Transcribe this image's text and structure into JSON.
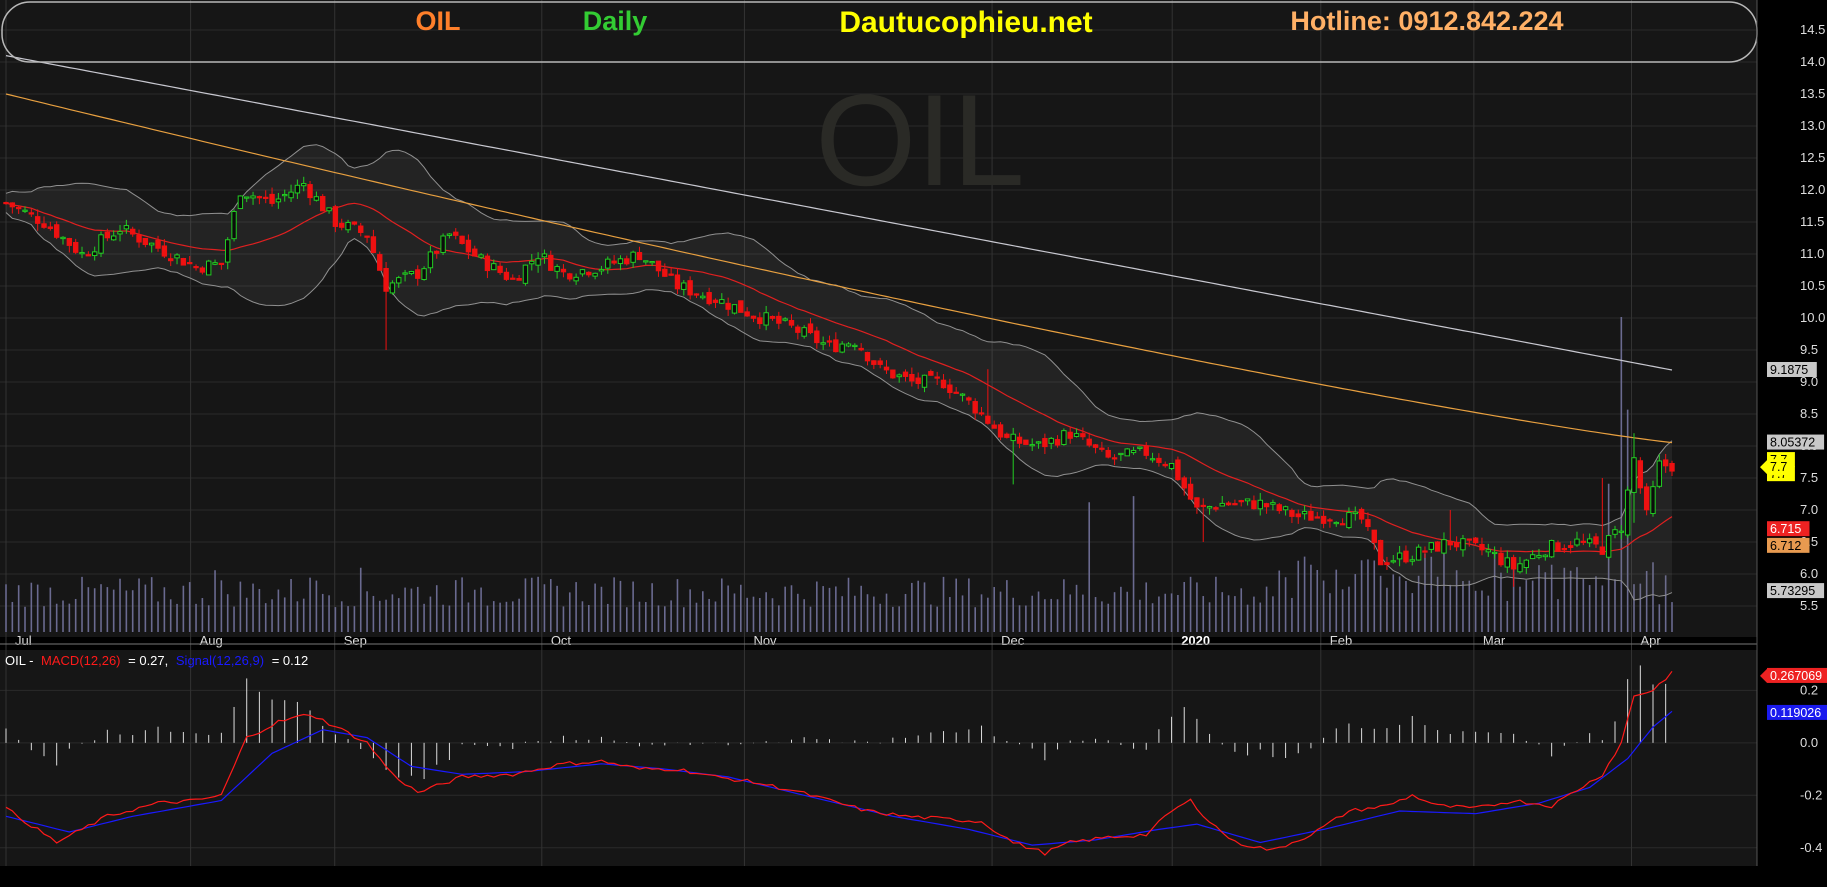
{
  "header": {
    "symbol": "OIL",
    "period": "Daily",
    "site": "Dautucophieu.net",
    "hotline": "Hotline: 0912.842.224"
  },
  "colors": {
    "background": "#000000",
    "plot_bg": "#161616",
    "up": "#22cc22",
    "down": "#ee1111",
    "symbol_text": "#ff7f2a",
    "period_text": "#33cc33",
    "site_text": "#ffff00",
    "hotline_text": "#ffb066",
    "ma_red": "#e02020",
    "ma_orange": "#e8a040",
    "ma_white": "#c8c8d0",
    "bollinger": "#909090",
    "volume": "#6a6a90",
    "macd": "#ff1a1a",
    "signal": "#1a1aff",
    "hist": "#dcdcdc"
  },
  "watermark": "OIL",
  "chart_data": [
    {
      "type": "candlestick",
      "title": "OIL Daily",
      "ylim": [
        5.25,
        14.5
      ],
      "y_ticks": [
        "5.5",
        "6.0",
        "6.5",
        "7.0",
        "7.5",
        "8.0",
        "8.5",
        "9.0",
        "9.5",
        "10.0",
        "10.5",
        "11.0",
        "11.5",
        "12.0",
        "12.5",
        "13.0",
        "13.5",
        "14.0",
        "14.5"
      ],
      "x_ticks": [
        "Jul",
        "Aug",
        "Sep",
        "Oct",
        "Nov",
        "Dec",
        "2020",
        "Feb",
        "Mar",
        "Apr"
      ],
      "anchors": [
        [
          0,
          11.8
        ],
        [
          6,
          11.5
        ],
        [
          12,
          11.0
        ],
        [
          18,
          11.4
        ],
        [
          24,
          11.1
        ],
        [
          30,
          10.8
        ],
        [
          34,
          10.85
        ],
        [
          37,
          12.0
        ],
        [
          42,
          11.8
        ],
        [
          47,
          12.1
        ],
        [
          52,
          11.5
        ],
        [
          57,
          11.3
        ],
        [
          60,
          10.5
        ],
        [
          65,
          10.7
        ],
        [
          70,
          11.3
        ],
        [
          75,
          10.9
        ],
        [
          80,
          10.6
        ],
        [
          84,
          11.0
        ],
        [
          88,
          10.7
        ],
        [
          94,
          10.8
        ],
        [
          100,
          11.0
        ],
        [
          106,
          10.5
        ],
        [
          112,
          10.3
        ],
        [
          118,
          10.05
        ],
        [
          124,
          9.85
        ],
        [
          130,
          9.55
        ],
        [
          134,
          9.65
        ],
        [
          138,
          9.2
        ],
        [
          143,
          9.0
        ],
        [
          148,
          9.0
        ],
        [
          153,
          8.6
        ],
        [
          158,
          8.1
        ],
        [
          163,
          8.0
        ],
        [
          168,
          8.2
        ],
        [
          174,
          7.8
        ],
        [
          180,
          7.9
        ],
        [
          184,
          7.7
        ],
        [
          188,
          7.0
        ],
        [
          192,
          7.1
        ],
        [
          198,
          7.1
        ],
        [
          204,
          6.9
        ],
        [
          210,
          6.9
        ],
        [
          214,
          6.85
        ],
        [
          217,
          6.2
        ],
        [
          222,
          6.3
        ],
        [
          228,
          6.5
        ],
        [
          234,
          6.35
        ],
        [
          238,
          6.1
        ],
        [
          243,
          6.4
        ],
        [
          248,
          6.5
        ],
        [
          252,
          6.4
        ],
        [
          255,
          6.75
        ],
        [
          257,
          7.8
        ],
        [
          259,
          6.9
        ],
        [
          261,
          7.7
        ],
        [
          263,
          7.7
        ]
      ],
      "volume_scale": {
        "unit": "shares",
        "max_bar": 2550000
      },
      "volume_spikes": [
        [
          171,
          1050000
        ],
        [
          178,
          1100000
        ],
        [
          253,
          1200000
        ],
        [
          255,
          2550000
        ],
        [
          256,
          1800000
        ]
      ],
      "indicators": {
        "ma_red_last": 6.715,
        "ma_orange_last": 8.05372,
        "ma_white_last": 9.1875,
        "bollinger_lower_last": 5.73295,
        "bollinger_upper_last": 8.05372,
        "ma_orange_start": 13.5,
        "ma_white_start": 14.1
      },
      "price_labels": [
        {
          "text": "9.1875",
          "value": 9.1875,
          "bg": "#c8c8c8",
          "fg": "#000000"
        },
        {
          "text": "8.05372",
          "value": 8.05372,
          "bg": "#c8c8c8",
          "fg": "#000000"
        },
        {
          "text": "7.7",
          "value": 7.78,
          "bg": "#ffff00",
          "fg": "#000000"
        },
        {
          "text": "7.7",
          "value": 7.56,
          "bg": "#ffff00",
          "fg": "#000000"
        },
        {
          "text": "6.715",
          "value": 6.7,
          "bg": "#ee2222",
          "fg": "#ffffff"
        },
        {
          "text": "6.712",
          "value": 6.44,
          "bg": "#e89a50",
          "fg": "#000000"
        },
        {
          "text": "5.73295",
          "value": 5.73295,
          "bg": "#c8c8c8",
          "fg": "#000000"
        }
      ],
      "pointer_label": {
        "text": "7.7",
        "value": 7.67
      }
    },
    {
      "type": "line",
      "title": "OIL - MACD(12,26) = 0.27, Signal(12,26,9) = 0.12",
      "legend": {
        "symbol": "OIL -",
        "macd_name": "MACD(12,26)",
        "macd_value": "= 0.27,",
        "signal_name": "Signal(12,26,9)",
        "signal_value": "= 0.12"
      },
      "ylim": [
        -0.42,
        0.27
      ],
      "y_ticks": [
        "0.2",
        "0.0",
        "-0.2",
        "-0.4"
      ],
      "macd_anchors": [
        [
          0,
          -0.25
        ],
        [
          8,
          -0.38
        ],
        [
          16,
          -0.28
        ],
        [
          24,
          -0.23
        ],
        [
          30,
          -0.22
        ],
        [
          34,
          -0.2
        ],
        [
          38,
          0.02
        ],
        [
          43,
          0.08
        ],
        [
          48,
          0.11
        ],
        [
          53,
          0.05
        ],
        [
          57,
          0.0
        ],
        [
          61,
          -0.12
        ],
        [
          65,
          -0.19
        ],
        [
          72,
          -0.13
        ],
        [
          80,
          -0.12
        ],
        [
          88,
          -0.08
        ],
        [
          94,
          -0.07
        ],
        [
          100,
          -0.1
        ],
        [
          106,
          -0.1
        ],
        [
          112,
          -0.13
        ],
        [
          118,
          -0.15
        ],
        [
          124,
          -0.18
        ],
        [
          130,
          -0.22
        ],
        [
          136,
          -0.26
        ],
        [
          142,
          -0.28
        ],
        [
          148,
          -0.29
        ],
        [
          154,
          -0.3
        ],
        [
          159,
          -0.38
        ],
        [
          164,
          -0.42
        ],
        [
          168,
          -0.38
        ],
        [
          174,
          -0.36
        ],
        [
          180,
          -0.35
        ],
        [
          184,
          -0.26
        ],
        [
          187,
          -0.22
        ],
        [
          190,
          -0.3
        ],
        [
          194,
          -0.38
        ],
        [
          200,
          -0.41
        ],
        [
          206,
          -0.35
        ],
        [
          212,
          -0.26
        ],
        [
          218,
          -0.24
        ],
        [
          222,
          -0.2
        ],
        [
          226,
          -0.24
        ],
        [
          232,
          -0.25
        ],
        [
          238,
          -0.22
        ],
        [
          244,
          -0.24
        ],
        [
          248,
          -0.18
        ],
        [
          252,
          -0.12
        ],
        [
          255,
          0.0
        ],
        [
          257,
          0.18
        ],
        [
          260,
          0.2
        ],
        [
          263,
          0.27
        ]
      ],
      "signal_anchors": [
        [
          0,
          -0.28
        ],
        [
          10,
          -0.34
        ],
        [
          20,
          -0.28
        ],
        [
          34,
          -0.22
        ],
        [
          42,
          -0.04
        ],
        [
          50,
          0.05
        ],
        [
          57,
          0.02
        ],
        [
          64,
          -0.09
        ],
        [
          72,
          -0.12
        ],
        [
          82,
          -0.11
        ],
        [
          94,
          -0.08
        ],
        [
          104,
          -0.1
        ],
        [
          114,
          -0.13
        ],
        [
          126,
          -0.2
        ],
        [
          140,
          -0.28
        ],
        [
          152,
          -0.33
        ],
        [
          162,
          -0.39
        ],
        [
          172,
          -0.37
        ],
        [
          182,
          -0.33
        ],
        [
          188,
          -0.31
        ],
        [
          198,
          -0.38
        ],
        [
          208,
          -0.33
        ],
        [
          220,
          -0.26
        ],
        [
          232,
          -0.27
        ],
        [
          242,
          -0.23
        ],
        [
          250,
          -0.17
        ],
        [
          256,
          -0.06
        ],
        [
          260,
          0.06
        ],
        [
          263,
          0.12
        ]
      ],
      "macd_label": {
        "text": "0.267069",
        "value": 0.255,
        "bg": "#ee2222",
        "fg": "#ffffff"
      },
      "signal_label": {
        "text": "0.119026",
        "value": 0.114,
        "bg": "#1a1aee",
        "fg": "#ffffff"
      }
    }
  ]
}
